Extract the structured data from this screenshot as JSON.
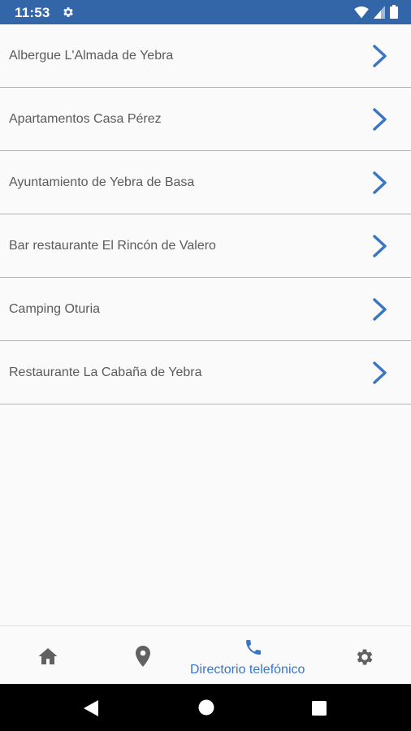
{
  "status_bar": {
    "time": "11:53",
    "icons": [
      "settings-gear-icon",
      "wifi-icon",
      "signal-icon",
      "battery-icon"
    ],
    "background": "#3266a8"
  },
  "directory": {
    "items": [
      {
        "label": "Albergue L'Almada de Yebra"
      },
      {
        "label": "Apartamentos Casa Pérez"
      },
      {
        "label": "Ayuntamiento de Yebra de Basa"
      },
      {
        "label": "Bar restaurante El Rincón de Valero"
      },
      {
        "label": "Camping Oturia"
      },
      {
        "label": "Restaurante La Cabaña de Yebra"
      }
    ],
    "chevron_icon": "chevron-right-icon",
    "divider_color": "#9ab9c2",
    "accent": "#3b76c4"
  },
  "bottom_nav": {
    "items": [
      {
        "icon": "home-icon",
        "label": ""
      },
      {
        "icon": "location-pin-icon",
        "label": ""
      },
      {
        "icon": "phone-icon",
        "label": "Directorio telefónico",
        "active": true
      },
      {
        "icon": "settings-icon",
        "label": ""
      }
    ],
    "active_color": "#3b76c4",
    "inactive_color": "#616161"
  },
  "system_nav": {
    "buttons": [
      "back-icon",
      "home-circle-icon",
      "recents-icon"
    ]
  }
}
